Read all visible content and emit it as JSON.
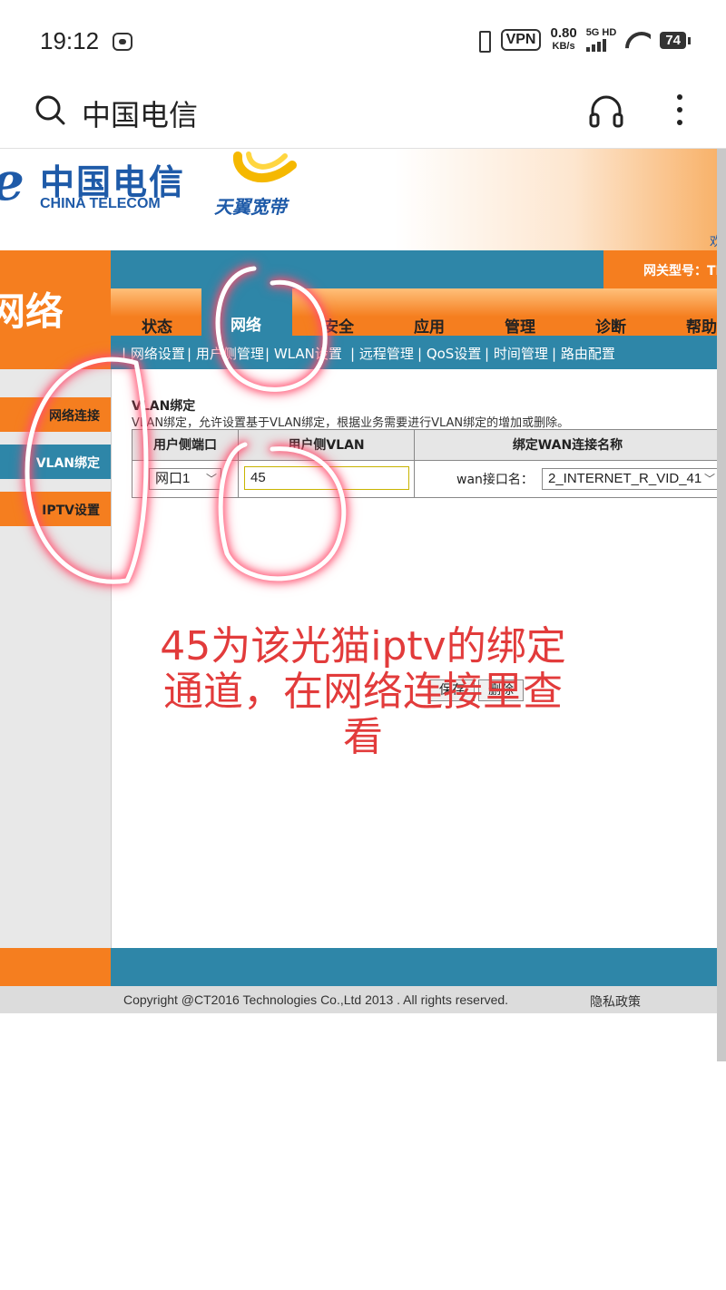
{
  "status_bar": {
    "time": "19:12",
    "vpn": "VPN",
    "speed_value": "0.80",
    "speed_unit": "KB/s",
    "network": "5G HD",
    "battery": "74"
  },
  "browser": {
    "title": "中国电信"
  },
  "router": {
    "brand_cn": "中国电信",
    "brand_en": "CHINA TELECOM",
    "brand_e": "e",
    "tianyi": "天翼宽带",
    "welcome_partial": "欢",
    "section_tab": "网络",
    "gateway_model_label": "网关型号：TE",
    "tabs": [
      {
        "label": "状态"
      },
      {
        "label": "网络"
      },
      {
        "label": "安全"
      },
      {
        "label": "应用"
      },
      {
        "label": "管理"
      },
      {
        "label": "诊断"
      },
      {
        "label": "帮助"
      }
    ],
    "subnav": [
      {
        "label": "网络设置"
      },
      {
        "label": "用户侧管理"
      },
      {
        "label": "WLAN设置"
      },
      {
        "label": "远程管理"
      },
      {
        "label": "QoS设置"
      },
      {
        "label": "时间管理"
      },
      {
        "label": "路由配置"
      }
    ],
    "sidebar": [
      {
        "label": "网络连接"
      },
      {
        "label": "VLAN绑定"
      },
      {
        "label": "IPTV设置"
      }
    ],
    "content": {
      "title": "VLAN绑定",
      "description": "VLAN绑定，允许设置基于VLAN绑定，根据业务需要进行VLAN绑定的增加或删除。",
      "columns": [
        "用户侧端口",
        "用户侧VLAN",
        "绑定WAN连接名称"
      ],
      "port_select": "网口1",
      "vlan_value": "45",
      "wan_label": "wan接口名：",
      "wan_select": "2_INTERNET_R_VID_41",
      "save_button": "保存",
      "delete_button": "删除"
    },
    "footer": {
      "copyright": "Copyright @CT2016 Technologies Co.,Ltd 2013 . All rights reserved.",
      "privacy": "隐私政策"
    }
  },
  "annotation": {
    "text": "45为该光猫iptv的绑定通道，在网络连接里查看",
    "color": "#e23b3b"
  },
  "colors": {
    "orange": "#f57e1f",
    "teal": "#2e86a8",
    "brand_blue": "#1e5aa8"
  }
}
